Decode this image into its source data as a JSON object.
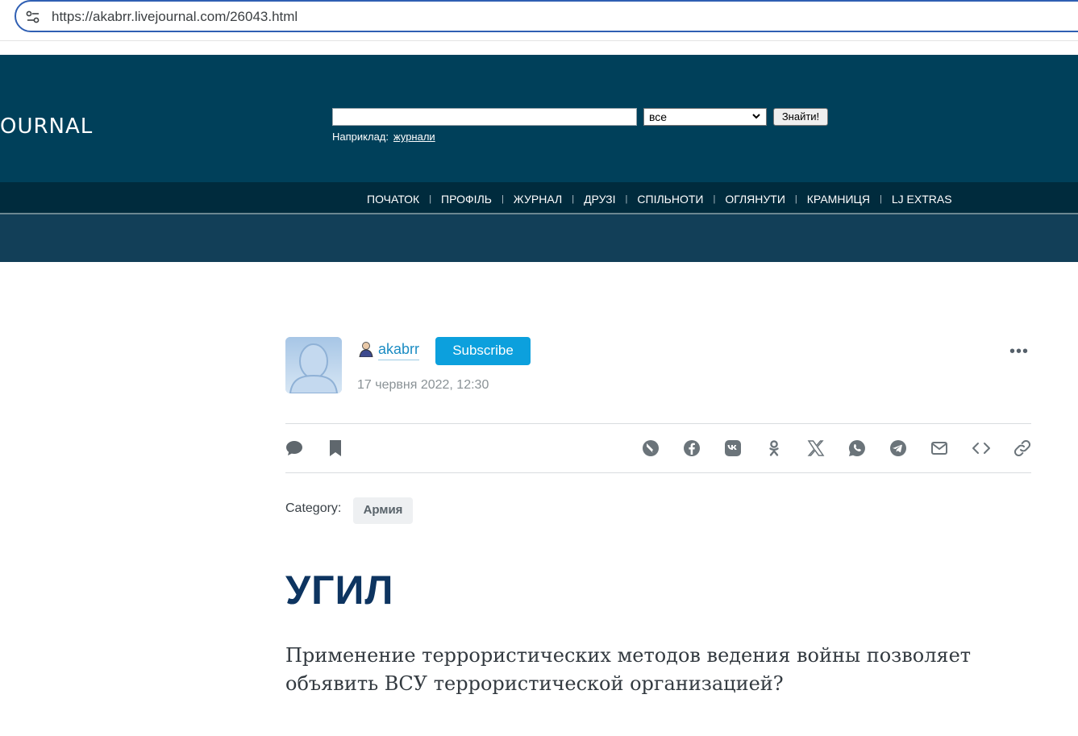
{
  "browser": {
    "url": "https://akabrr.livejournal.com/26043.html"
  },
  "header": {
    "logo_text": "OURNAL",
    "search": {
      "input_value": "",
      "select_value": "все",
      "button_label": "Знайти!"
    },
    "example_label": "Наприклад:",
    "example_link": "журнали",
    "nav": [
      "ПОЧАТОК",
      "ПРОФІЛЬ",
      "ЖУРНАЛ",
      "ДРУЗІ",
      "СПІЛЬНОТИ",
      "ОГЛЯНУТИ",
      "КРАМНИЦЯ",
      "LJ EXTRAS"
    ]
  },
  "post": {
    "username": "akabrr",
    "subscribe_label": "Subscribe",
    "date": "17 червня 2022, 12:30",
    "more_label": "•••",
    "actions_left": [
      "comment-icon",
      "bookmark-icon"
    ],
    "share_icons": [
      "livejournal-share-icon",
      "facebook-icon",
      "vk-icon",
      "odnoklassniki-icon",
      "x-twitter-icon",
      "whatsapp-icon",
      "telegram-icon",
      "email-icon",
      "embed-code-icon",
      "copy-link-icon"
    ],
    "category_label": "Category:",
    "category_tag": "Армия",
    "title": "УГИЛ",
    "text": "Применение террористических методов ведения войны позволяет объявить ВСУ террористической организацией?"
  },
  "colors": {
    "header_bg": "#00405a",
    "nav_bg": "#002b3d",
    "subscribe_bg": "#0ca0dd",
    "title_color": "#0d3460",
    "username_color": "#1b8cc3"
  }
}
